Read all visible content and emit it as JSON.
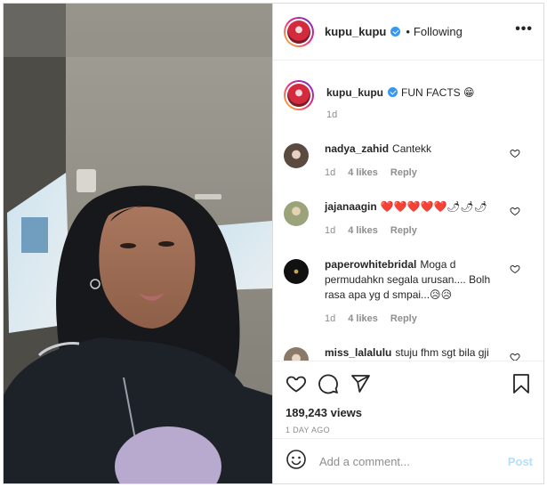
{
  "post": {
    "username": "kupu_kupu",
    "follow_status": "Following",
    "more_label": "•••",
    "caption": "FUN FACTS 😁",
    "caption_age": "1d",
    "views": "189,243 views",
    "posted_ago": "1 DAY AGO"
  },
  "comments": [
    {
      "username": "nadya_zahid",
      "text": "Cantekk",
      "age": "1d",
      "likes": "4 likes",
      "reply": "Reply",
      "avatar_color": "#5a4a40"
    },
    {
      "username": "jajanaagin",
      "text": "❤️❤️❤️❤️❤️🌶🌶🌶",
      "age": "1d",
      "likes": "4 likes",
      "reply": "Reply",
      "avatar_color": "#9aa37a"
    },
    {
      "username": "paperowhitebridal",
      "text": "Moga d permudahkn segala urusan.... Bolh rasa apa yg d smpai...😥😥",
      "age": "1d",
      "likes": "4 likes",
      "reply": "Reply",
      "avatar_color": "#111111"
    },
    {
      "username": "miss_lalalulu",
      "text": "stuju fhm sgt bila gji kita still kita yg kena tanya",
      "age": "",
      "likes": "",
      "reply": "",
      "avatar_color": "#8a7a6a"
    }
  ],
  "composer": {
    "placeholder": "Add a comment...",
    "post_label": "Post"
  },
  "icons": [
    "heart-icon",
    "comment-icon",
    "share-icon",
    "bookmark-icon",
    "emoji-icon",
    "verified-icon",
    "more-icon"
  ],
  "colors": {
    "verified": "#3897f0",
    "post_button": "#b2dffc",
    "heart_red": "#e0245e"
  }
}
